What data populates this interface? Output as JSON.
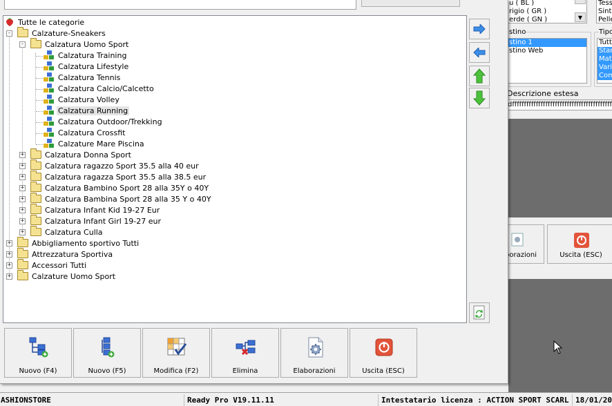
{
  "background": {
    "color_list": [
      "u ( BL )",
      "rigio ( GR )",
      "erde ( GN )"
    ],
    "type_list": [
      "Tess",
      "Sinte",
      "Pelle"
    ],
    "listino_label": "stino",
    "listino_items": [
      "stino 1",
      "stino Web"
    ],
    "tipo_label": "Tipo",
    "tipo_items": [
      "Tutti",
      "Stan",
      "Matri",
      "Varia",
      "Com"
    ],
    "descrizione_label": "Descrizione estesa",
    "descrizione_value": "dfffffffffffffffffffffffffffffffffffffffffffffffffffffffffff",
    "elaborazioni_label": "borazioni",
    "uscita_label": "Uscita (ESC)"
  },
  "tree": {
    "root_label": "Tutte le categorie",
    "nodes": [
      {
        "label": "Calzature-Sneakers"
      },
      {
        "label": "Calzatura Uomo Sport"
      },
      {
        "label": "Calzatura Training"
      },
      {
        "label": "Calzatura Lifestyle"
      },
      {
        "label": "Calzatura Tennis"
      },
      {
        "label": "Calzatura Calcio/Calcetto"
      },
      {
        "label": "Calzatura Volley"
      },
      {
        "label": "Calzatura Running"
      },
      {
        "label": "Calzatura Outdoor/Trekking"
      },
      {
        "label": "Calzatura Crossfit"
      },
      {
        "label": "Calzature Mare Piscina"
      },
      {
        "label": "Calzatura Donna Sport"
      },
      {
        "label": "Calzatura ragazzo Sport 35.5 alla 40 eur"
      },
      {
        "label": "Calzatura ragazza Sport 35.5 alla 38.5 eur"
      },
      {
        "label": "Calzatura Bambino Sport 28 alla 35Y o 40Y"
      },
      {
        "label": "Calzatura Bambina Sport 28 alla 35 Y o 40Y"
      },
      {
        "label": "Calzatura Infant Kid 19-27 Eur"
      },
      {
        "label": "Calzatura Infant Girl 19-27 eur"
      },
      {
        "label": "Calzatura Culla"
      },
      {
        "label": "Abbigliamento sportivo Tutti"
      },
      {
        "label": "Attrezzatura Sportiva"
      },
      {
        "label": "Accessori Tutti"
      },
      {
        "label": "Calzature Uomo Sport"
      }
    ]
  },
  "buttons": {
    "nuovo_f4": "Nuovo (F4)",
    "nuovo_f5": "Nuovo (F5)",
    "modifica": "Modifica (F2)",
    "elimina": "Elimina",
    "elaborazioni": "Elaborazioni",
    "uscita": "Uscita (ESC)"
  },
  "statusbar": {
    "app": "ASHIONSTORE",
    "version": "Ready Pro V19.11.11",
    "licenza": "Intestatario licenza : ACTION SPORT SCARL",
    "date": "18/01/20"
  },
  "colors": {
    "selection": "#3399ff",
    "dark_area": "#6d6d6d"
  }
}
